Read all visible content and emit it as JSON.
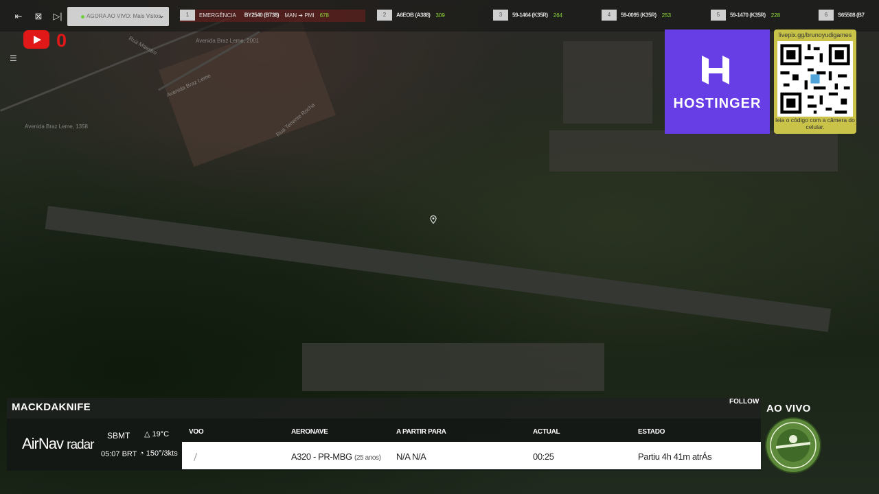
{
  "ticker": {
    "live_select": "AGORA AO VIVO: Mais Vistos",
    "emergency": {
      "num": "1",
      "label": "EMERGÊNCIA",
      "flight": "BY2540 (B738)",
      "route": "MAN ➔ PMI",
      "count": "678"
    },
    "items": [
      {
        "num": "2",
        "flight": "A6EOB (A388)",
        "count": "309"
      },
      {
        "num": "3",
        "flight": "59-1464 (K35R)",
        "count": "264"
      },
      {
        "num": "4",
        "flight": "59-0095 (K35R)",
        "count": "253"
      },
      {
        "num": "5",
        "flight": "59-1470 (K35R)",
        "count": "228"
      },
      {
        "num": "6",
        "flight": "S65508 (B7",
        "count": ""
      }
    ]
  },
  "youtube": {
    "count": "0"
  },
  "sponsor": {
    "name": "HOSTINGER",
    "url": "livepix.gg/brunoyudigames",
    "caption": "leia o código com a câmera do celular."
  },
  "map_labels": [
    "Avenida Braz Leme, 2001",
    "Avenida Braz Leme",
    "Avenida Braz Leme, 1358",
    "Rua Maestro",
    "Rua Tenente Rocha"
  ],
  "panel": {
    "user": "MACKDAKNIFE",
    "follow": "FOLLOW",
    "brand": "AirNav",
    "brand2": "radar",
    "airport": "SBMT",
    "time": "05:07 BRT",
    "temp": "19°C",
    "wind": "150°/3kts",
    "headers": {
      "voo": "VOO",
      "aeronave": "AERONAVE",
      "partir": "A PARTIR PARA",
      "actual": "ACTUAL",
      "estado": "ESTADO"
    },
    "row": {
      "aeronave": "A320 - PR-MBG",
      "age": "(25 anos)",
      "partir": "N/A N/A",
      "actual": "00:25",
      "estado": "Partiu 4h 41m atrÁs"
    }
  },
  "ao_vivo": "AO VIVO",
  "colors": {
    "hostinger": "#673de6",
    "youtube": "#e01818",
    "ticker_count": "#8fdc3a"
  }
}
